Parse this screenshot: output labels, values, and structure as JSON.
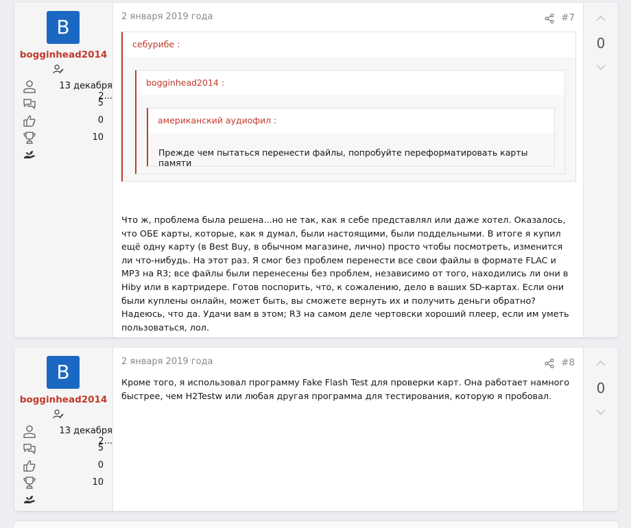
{
  "posts": [
    {
      "user": {
        "avatar_letter": "B",
        "username": "bogginhead2014",
        "joined": "13 декабря 2...",
        "messages": "5",
        "reactions": "0",
        "points": "10"
      },
      "date": "2 января 2019 года",
      "number": "#7",
      "score": "0",
      "quote": {
        "author": "себурибе :",
        "inner": {
          "author": "bogginhead2014 :",
          "inner": {
            "author": "американский аудиофил :",
            "text": "Прежде чем пытаться перенести файлы, попробуйте переформатировать карты памяти"
          }
        }
      },
      "body": "Что ж, проблема была решена...но не так, как я себе представлял или даже хотел. Оказалось, что ОБЕ карты, которые, как я думал, были настоящими, были поддельными. В итоге я купил ещё одну карту (в Best Buy, в обычном магазине, лично) просто чтобы посмотреть, изменится ли что-нибудь. На этот раз. Я смог без проблем перенести все свои файлы в формате FLAC и MP3 на R3; все файлы были перенесены без проблем, независимо от того, находились ли они в Hiby или в картридере. Готов поспорить, что, к сожалению, дело в ваших SD-картах. Если они были куплены онлайн, может быть, вы сможете вернуть их и получить деньги обратно? Надеюсь, что да. Удачи вам в этом; R3 на самом деле чертовски хороший плеер, если им уметь пользоваться, лол."
    },
    {
      "user": {
        "avatar_letter": "B",
        "username": "bogginhead2014",
        "joined": "13 декабря 2...",
        "messages": "5",
        "reactions": "0",
        "points": "10"
      },
      "date": "2 января 2019 года",
      "number": "#8",
      "score": "0",
      "body": "Кроме того, я использовал программу Fake Flash Test для проверки карт. Она работает намного быстрее, чем H2Testw или любая другая программа для тестирования, которую я пробовал."
    }
  ],
  "icons": {
    "role": "user-edit-icon",
    "joined": "user-icon",
    "messages": "messages-icon",
    "reactions": "thumbs-up-icon",
    "points": "trophy-icon",
    "extra": "hand-plant-icon",
    "share": "share-icon",
    "vote_up": "chevron-up-icon",
    "vote_down": "chevron-down-icon"
  },
  "colors": {
    "username": "#c0392b",
    "avatar_bg": "#1b68c2",
    "quote_border": "#c0392b",
    "meta_text": "#8a8a8a"
  }
}
